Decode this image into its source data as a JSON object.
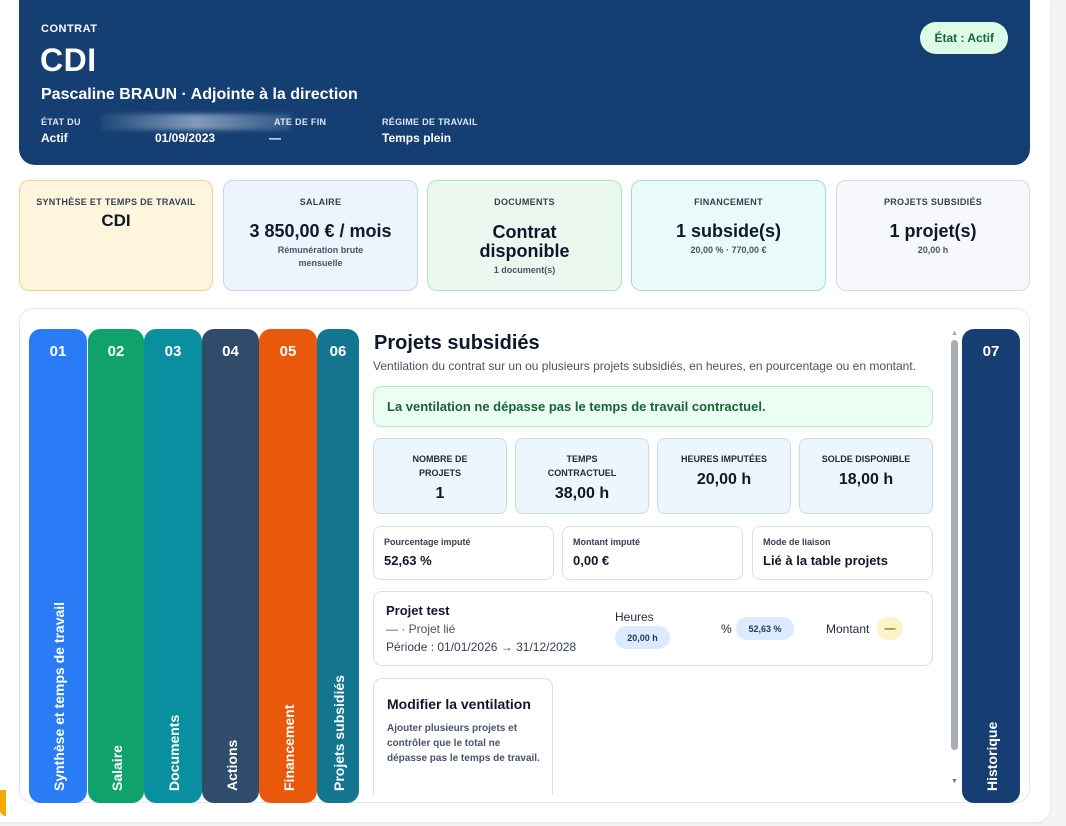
{
  "header": {
    "kicker": "CONTRAT",
    "title": "CDI",
    "subtitle": "Pascaline BRAUN · Adjointe à la direction",
    "status_pill": "État : Actif",
    "meta": [
      {
        "label": "ÉTAT DU",
        "value": "Actif"
      },
      {
        "label": "",
        "value": "01/09/2023"
      },
      {
        "label": "ATE DE FIN",
        "value": "—"
      },
      {
        "label": "RÉGIME DE TRAVAIL",
        "value": "Temps plein"
      }
    ]
  },
  "cards": [
    {
      "label": "SYNTHÈSE ET TEMPS DE TRAVAIL",
      "value": "CDI",
      "note": ""
    },
    {
      "label": "SALAIRE",
      "value": "3 850,00 € / mois",
      "note": "Rémunération brute mensuelle"
    },
    {
      "label": "DOCUMENTS",
      "value": "Contrat disponible",
      "note": "1 document(s)"
    },
    {
      "label": "FINANCEMENT",
      "value": "1 subside(s)",
      "note": "20,00 % · 770,00 €"
    },
    {
      "label": "PROJETS SUBSIDIÉS",
      "value": "1 projet(s)",
      "note": "20,00 h"
    }
  ],
  "tabs": [
    {
      "num": "01",
      "label": "Synthèse et temps de travail",
      "color": "#2a7cf6"
    },
    {
      "num": "02",
      "label": "Salaire",
      "color": "#0fa36b"
    },
    {
      "num": "03",
      "label": "Documents",
      "color": "#0a8fa1"
    },
    {
      "num": "04",
      "label": "Actions",
      "color": "#2f4c6b"
    },
    {
      "num": "05",
      "label": "Financement",
      "color": "#ea580c"
    },
    {
      "num": "06",
      "label": "Projets subsidiés",
      "color": "#137590"
    },
    {
      "num": "07",
      "label": "Historique",
      "color": "#163e73"
    }
  ],
  "content": {
    "title": "Projets subsidiés",
    "description": "Ventilation du contrat sur un ou plusieurs projets subsidiés, en heures, en pourcentage ou en montant.",
    "alert": "La ventilation ne dépasse pas le temps de travail contractuel.",
    "stats": [
      {
        "label": "NOMBRE DE PROJETS",
        "value": "1"
      },
      {
        "label": "TEMPS CONTRACTUEL",
        "value": "38,00 h"
      },
      {
        "label": "HEURES IMPUTÉES",
        "value": "20,00 h"
      },
      {
        "label": "SOLDE DISPONIBLE",
        "value": "18,00 h"
      }
    ],
    "minis": [
      {
        "label": "Pourcentage imputé",
        "value": "52,63 %"
      },
      {
        "label": "Montant imputé",
        "value": "0,00 €"
      },
      {
        "label": "Mode de liaison",
        "value": "Lié à la table projets"
      }
    ],
    "project": {
      "name": "Projet test",
      "type": "— · Projet lié",
      "period": "Période : 01/01/2026 → 31/12/2028",
      "hours_label": "Heures",
      "hours_value": "20,00 h",
      "percent_label": "%",
      "percent_value": "52,63 %",
      "amount_label": "Montant",
      "amount_value": "—"
    },
    "edit": {
      "title": "Modifier la ventilation",
      "description": "Ajouter plusieurs projets et contrôler que le total ne dépasse pas le temps de travail."
    }
  }
}
